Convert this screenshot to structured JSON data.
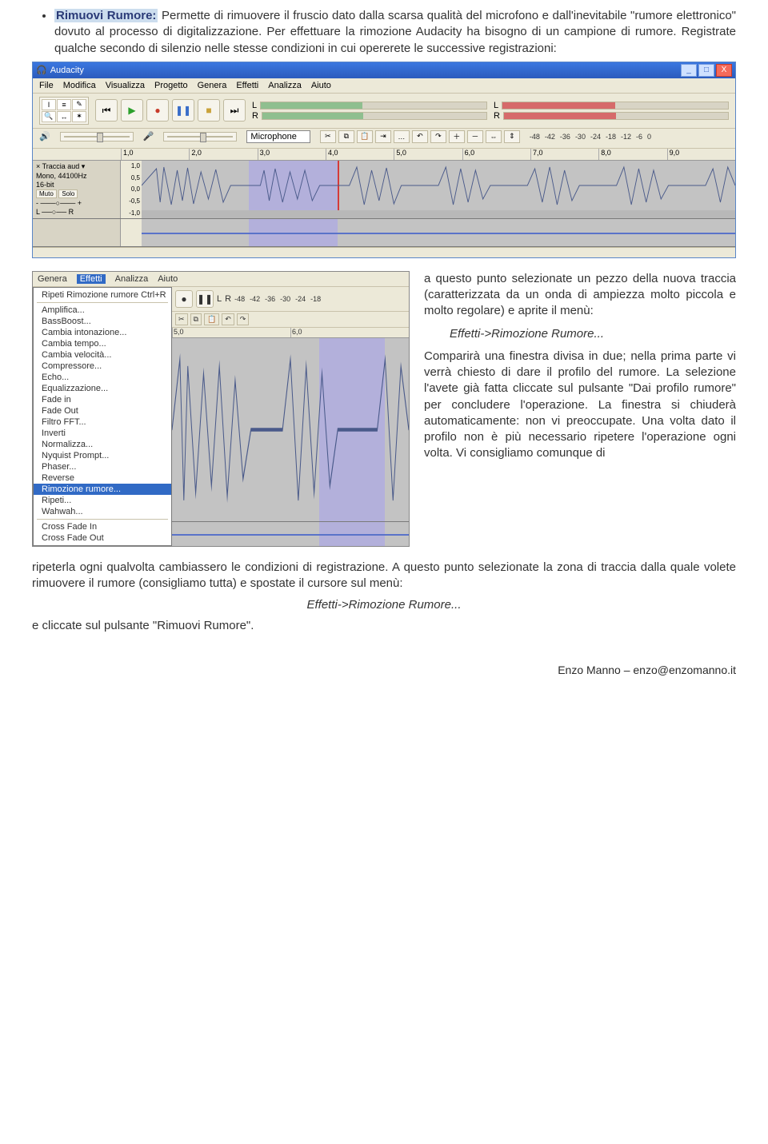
{
  "bullet": {
    "title": "Rimuovi Rumore:",
    "text": " Permette di rimuovere il fruscio dato dalla scarsa qualità del microfono e dall'inevitabile \"rumore elettronico\" dovuto al processo di digitalizzazione. Per effettuare la rimozione Audacity ha bisogno di un campione di rumore. Registrate qualche secondo di silenzio nelle stesse condizioni in cui opererete le successive registrazioni:"
  },
  "audacity": {
    "title": "Audacity",
    "win_buttons": {
      "min": "_",
      "max": "□",
      "close": "X"
    },
    "menu": [
      "File",
      "Modifica",
      "Visualizza",
      "Progetto",
      "Genera",
      "Effetti",
      "Analizza",
      "Aiuto"
    ],
    "meter_ticks": [
      "-48",
      "-42",
      "-36",
      "-30",
      "-24",
      "-18",
      "-12",
      "-6",
      "0"
    ],
    "mic_label": "Microphone",
    "lr": {
      "l": "L",
      "r": "R"
    },
    "ruler": [
      "1,0",
      "2,0",
      "3,0",
      "4,0",
      "5,0",
      "6,0",
      "7,0",
      "8,0",
      "9,0"
    ],
    "track": {
      "name": "Traccia aud",
      "info1": "Mono, 44100Hz",
      "info2": "16-bit",
      "mute": "Muto",
      "solo": "Solo",
      "pan_l": "L",
      "pan_r": "R",
      "scale": [
        "1,0",
        "0,5",
        "0,0",
        "-0,5",
        "-1,0"
      ]
    }
  },
  "fx": {
    "menu": [
      "Genera",
      "Effetti",
      "Analizza",
      "Aiuto"
    ],
    "top": "Ripeti Rimozione rumore  Ctrl+R",
    "items": [
      "Amplifica...",
      "BassBoost...",
      "Cambia intonazione...",
      "Cambia tempo...",
      "Cambia velocità...",
      "Compressore...",
      "Echo...",
      "Equalizzazione...",
      "Fade in",
      "Fade Out",
      "Filtro FFT...",
      "Inverti",
      "Normalizza...",
      "Nyquist Prompt...",
      "Phaser...",
      "Reverse",
      "Rimozione rumore...",
      "Ripeti...",
      "Wahwah..."
    ],
    "sep_items": [
      "Cross Fade In",
      "Cross Fade Out"
    ],
    "highlight": "Rimozione rumore...",
    "scale": [
      "5,0",
      "6,0"
    ],
    "ticks": [
      "-48",
      "-42",
      "-36",
      "-30",
      "-24",
      "-18"
    ]
  },
  "side_text": {
    "p1": "a questo punto selezionate un pezzo della nuova traccia (caratterizzata da un onda di ampiezza molto piccola e molto regolare) e aprite il menù:",
    "menu1": "Effetti->Rimozione Rumore...",
    "p2": "Comparirà una finestra divisa in due; nella prima parte vi verrà chiesto di dare il profilo del rumore. La selezione l'avete già fatta cliccate sul pulsante \"Dai profilo rumore\" per concludere l'operazione. La finestra si chiuderà automaticamente: non vi preoccupate. Una volta dato il profilo non è più necessario ripetere l'operazione ogni volta. Vi consigliamo comunque di"
  },
  "continuation": "ripeterla ogni qualvolta cambiassero le condizioni di registrazione. A questo punto selezionate la zona di traccia dalla quale volete rimuovere il rumore (consigliamo tutta) e spostate il cursore sul menù:",
  "menu2": "Effetti->Rimozione Rumore...",
  "closing": "e cliccate sul pulsante \"Rimuovi Rumore\".",
  "footer": "Enzo Manno – enzo@enzomanno.it"
}
